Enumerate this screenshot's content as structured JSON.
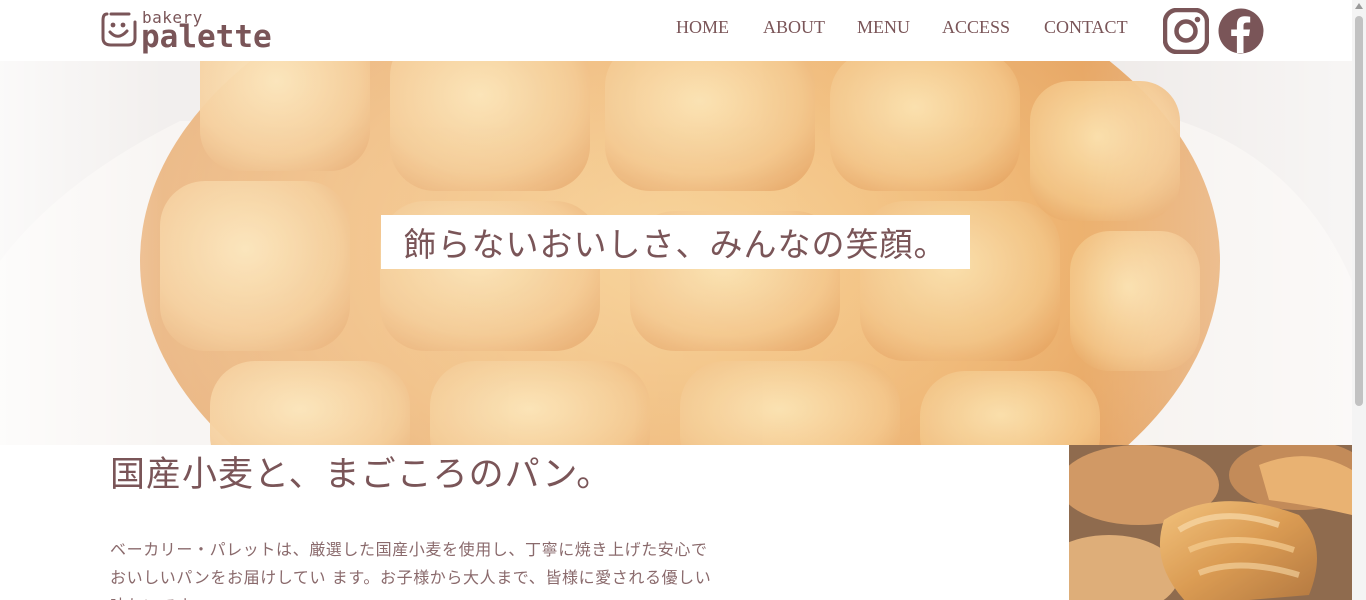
{
  "logo": {
    "small": "bakery",
    "big": "palette",
    "icon": "smiley-face-icon"
  },
  "nav": {
    "items": [
      {
        "label": "HOME"
      },
      {
        "label": "ABOUT"
      },
      {
        "label": "MENU"
      },
      {
        "label": "ACCESS"
      },
      {
        "label": "CONTACT"
      }
    ],
    "social": [
      "instagram-icon",
      "facebook-icon"
    ]
  },
  "hero": {
    "caption": "飾らないおいしさ、みんなの笑顔。",
    "image": "melon-pan-photo"
  },
  "section": {
    "heading": "国産小麦と、まごころのパン。",
    "body": "ベーカリー・パレットは、厳選した国産小麦を使用し、丁寧に焼き上げた安心でおいしいパンをお届けしてい ます。お子様から大人まで、皆様に愛される優しい味わいです。",
    "image": "croissant-photo"
  },
  "colors": {
    "brand": "#7a5558",
    "background": "#ffffff"
  }
}
